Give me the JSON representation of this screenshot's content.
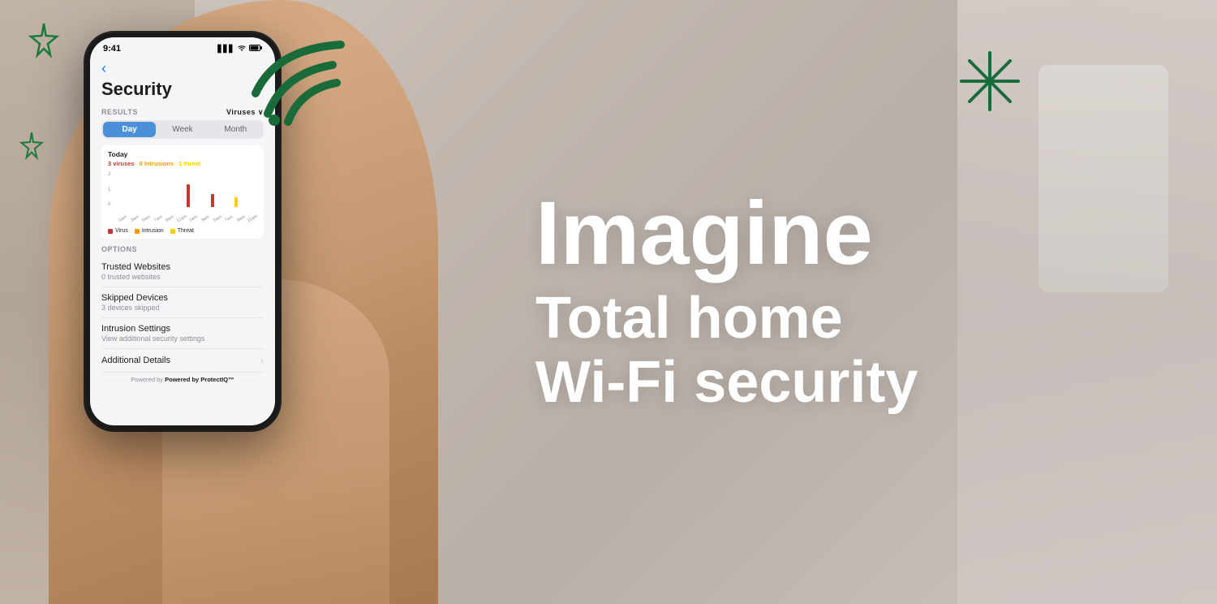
{
  "background": {
    "color": "#c8bfb8"
  },
  "decorations": {
    "star_top_left": "☆",
    "star_mid_left": "☆",
    "wifi_icon": "wifi-signal"
  },
  "phone": {
    "status_bar": {
      "time": "9:41",
      "signal": "▋▋▋",
      "wifi": "WiFi",
      "battery": "▊"
    },
    "back_button": "‹",
    "page_title": "Security",
    "results_section": {
      "label": "RESULTS",
      "viruses_dropdown": "Viruses ∨",
      "tabs": [
        "Day",
        "Week",
        "Month"
      ],
      "active_tab": "Day",
      "today_label": "Today",
      "stats": {
        "viruses": "3",
        "intrusions": "0",
        "threats": "1"
      },
      "chart": {
        "y_labels": [
          "2",
          "1",
          "0"
        ],
        "x_labels": [
          "1am",
          "3am",
          "5am",
          "7am",
          "9am",
          "11am",
          "1am",
          "3am",
          "5am",
          "7am",
          "9am",
          "11am"
        ],
        "bars": [
          {
            "virus": 0,
            "intrusion": 0,
            "threat": 0
          },
          {
            "virus": 0,
            "intrusion": 0,
            "threat": 0
          },
          {
            "virus": 0,
            "intrusion": 0,
            "threat": 0
          },
          {
            "virus": 0,
            "intrusion": 0,
            "threat": 0
          },
          {
            "virus": 0,
            "intrusion": 0,
            "threat": 0
          },
          {
            "virus": 0,
            "intrusion": 0,
            "threat": 0
          },
          {
            "virus": 2,
            "intrusion": 0,
            "threat": 0
          },
          {
            "virus": 0,
            "intrusion": 0,
            "threat": 0
          },
          {
            "virus": 1,
            "intrusion": 0,
            "threat": 0
          },
          {
            "virus": 0,
            "intrusion": 0,
            "threat": 0
          },
          {
            "virus": 0,
            "intrusion": 0,
            "threat": 1
          },
          {
            "virus": 0,
            "intrusion": 0,
            "threat": 0
          }
        ],
        "legend": [
          {
            "label": "Virus",
            "color": "#cc3333"
          },
          {
            "label": "Intrusion",
            "color": "#ff9900"
          },
          {
            "label": "Threat",
            "color": "#ffcc00"
          }
        ]
      }
    },
    "options_section": {
      "label": "OPTIONS",
      "items": [
        {
          "title": "Trusted Websites",
          "subtitle": "0 trusted websites",
          "has_arrow": false
        },
        {
          "title": "Skipped Devices",
          "subtitle": "3 devices skipped",
          "has_arrow": false
        },
        {
          "title": "Intrusion Settings",
          "subtitle": "View additional security settings",
          "has_arrow": false
        },
        {
          "title": "Additional Details",
          "subtitle": "",
          "has_arrow": true
        }
      ]
    },
    "powered_by": "Powered by ProtectIQ™"
  },
  "hero": {
    "imagine_label": "Imagine",
    "tagline_line1": "Total home",
    "tagline_line2": "Wi-Fi security"
  },
  "sparkle": {
    "lines": [
      "sparkle-line-1",
      "sparkle-line-2",
      "sparkle-line-3",
      "sparkle-line-4",
      "sparkle-line-5"
    ]
  }
}
